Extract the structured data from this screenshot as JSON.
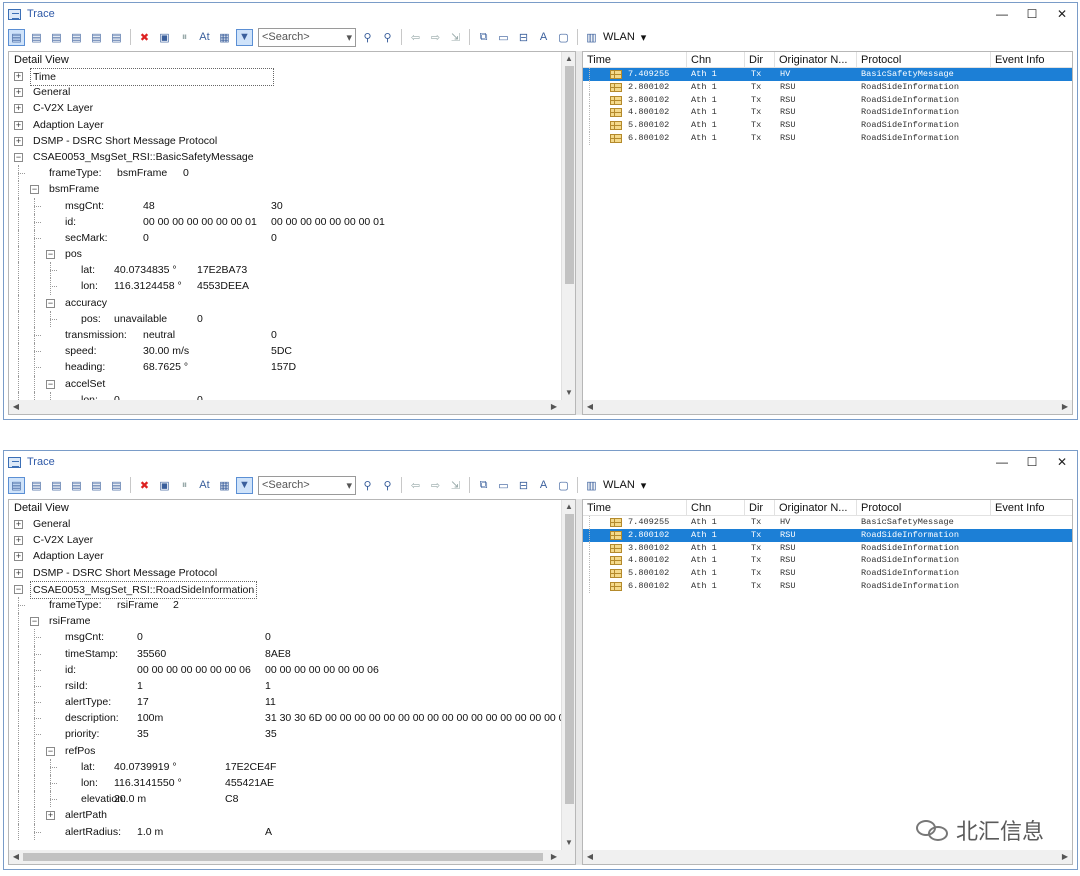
{
  "win1": {
    "title": "Trace",
    "search_placeholder": "<Search>",
    "wlan_label": "WLAN",
    "detail_header": "Detail View",
    "tree": [
      {
        "level": 0,
        "expander": "+",
        "label": "Time",
        "selected": true
      },
      {
        "level": 0,
        "expander": "+",
        "label": "General"
      },
      {
        "level": 0,
        "expander": "+",
        "label": "C-V2X Layer"
      },
      {
        "level": 0,
        "expander": "+",
        "label": "Adaption Layer"
      },
      {
        "level": 0,
        "expander": "+",
        "label": "DSMP - DSRC Short Message Protocol"
      },
      {
        "level": 0,
        "expander": "-",
        "label": "CSAE0053_MsgSet_RSI::BasicSafetyMessage"
      },
      {
        "level": 1,
        "label": "frameType:",
        "v1": "bsmFrame",
        "v2": "0"
      },
      {
        "level": 1,
        "expander": "-",
        "label": "bsmFrame"
      },
      {
        "level": 2,
        "label": "msgCnt:",
        "v1": "48",
        "v2": "30"
      },
      {
        "level": 2,
        "label": "id:",
        "v1": "00 00 00 00 00 00 00 01",
        "v2": "00 00 00 00 00 00 00 01"
      },
      {
        "level": 2,
        "label": "secMark:",
        "v1": "0",
        "v2": "0"
      },
      {
        "level": 2,
        "expander": "-",
        "label": "pos"
      },
      {
        "level": 3,
        "label": "lat:",
        "v1": "40.0734835 °",
        "v2": "17E2BA73"
      },
      {
        "level": 3,
        "label": "lon:",
        "v1": "116.3124458 °",
        "v2": "4553DEEA"
      },
      {
        "level": 2,
        "expander": "-",
        "label": "accuracy"
      },
      {
        "level": 3,
        "label": "pos:",
        "v1": "unavailable",
        "v2": "0"
      },
      {
        "level": 2,
        "label": "transmission:",
        "v1": "neutral",
        "v2": "0"
      },
      {
        "level": 2,
        "label": "speed:",
        "v1": "30.00 m/s",
        "v2": "5DC"
      },
      {
        "level": 2,
        "label": "heading:",
        "v1": "68.7625 °",
        "v2": "157D"
      },
      {
        "level": 2,
        "expander": "-",
        "label": "accelSet"
      },
      {
        "level": 3,
        "label": "lon:",
        "v1": "0",
        "v2": "0"
      },
      {
        "level": 3,
        "label": "lat:",
        "v1": "0",
        "v2": "0"
      }
    ],
    "selected_row": 0
  },
  "win2": {
    "title": "Trace",
    "search_placeholder": "<Search>",
    "wlan_label": "WLAN",
    "detail_header": "Detail View",
    "tree": [
      {
        "level": 0,
        "expander": "+",
        "label": "General"
      },
      {
        "level": 0,
        "expander": "+",
        "label": "C-V2X Layer"
      },
      {
        "level": 0,
        "expander": "+",
        "label": "Adaption Layer"
      },
      {
        "level": 0,
        "expander": "+",
        "label": "DSMP - DSRC Short Message Protocol"
      },
      {
        "level": 0,
        "expander": "-",
        "label": "CSAE0053_MsgSet_RSI::RoadSideInformation",
        "selected": true
      },
      {
        "level": 1,
        "label": "frameType:",
        "v1": "rsiFrame",
        "v2": "2"
      },
      {
        "level": 1,
        "expander": "-",
        "label": "rsiFrame"
      },
      {
        "level": 2,
        "label": "msgCnt:",
        "v1": "0",
        "v2": "0"
      },
      {
        "level": 2,
        "label": "timeStamp:",
        "v1": "35560",
        "v2": "8AE8"
      },
      {
        "level": 2,
        "label": "id:",
        "v1": "00 00 00 00 00 00 00 06",
        "v2": "00 00 00 00 00 00 00 06"
      },
      {
        "level": 2,
        "label": "rsiId:",
        "v1": "1",
        "v2": "1"
      },
      {
        "level": 2,
        "label": "alertType:",
        "v1": "17",
        "v2": "11"
      },
      {
        "level": 2,
        "label": "description:",
        "v1": "100m",
        "v2": "31 30 30 6D 00 00 00 00 00 00 00 00 00 00 00 00 00 00 00 00 00 00"
      },
      {
        "level": 2,
        "label": "priority:",
        "v1": "35",
        "v2": "35"
      },
      {
        "level": 2,
        "expander": "-",
        "label": "refPos"
      },
      {
        "level": 3,
        "label": "lat:",
        "v1": "40.0739919 °",
        "v2": "17E2CE4F"
      },
      {
        "level": 3,
        "label": "lon:",
        "v1": "116.3141550 °",
        "v2": "455421AE"
      },
      {
        "level": 3,
        "label": "elevation:",
        "v1": "20.0 m",
        "v2": "C8"
      },
      {
        "level": 2,
        "expander": "+",
        "label": "alertPath"
      },
      {
        "level": 2,
        "label": "alertRadius:",
        "v1": "1.0 m",
        "v2": "A"
      }
    ],
    "selected_row": 1
  },
  "columns": [
    "Time",
    "Chn",
    "Dir",
    "Originator N...",
    "Protocol",
    "Event Info"
  ],
  "trace_rows": [
    {
      "time": "7.409255",
      "chn": "Ath 1",
      "dir": "Tx",
      "orig": "HV",
      "proto": "BasicSafetyMessage"
    },
    {
      "time": "2.800102",
      "chn": "Ath 1",
      "dir": "Tx",
      "orig": "RSU",
      "proto": "RoadSideInformation"
    },
    {
      "time": "3.800102",
      "chn": "Ath 1",
      "dir": "Tx",
      "orig": "RSU",
      "proto": "RoadSideInformation"
    },
    {
      "time": "4.800102",
      "chn": "Ath 1",
      "dir": "Tx",
      "orig": "RSU",
      "proto": "RoadSideInformation"
    },
    {
      "time": "5.800102",
      "chn": "Ath 1",
      "dir": "Tx",
      "orig": "RSU",
      "proto": "RoadSideInformation"
    },
    {
      "time": "6.800102",
      "chn": "Ath 1",
      "dir": "Tx",
      "orig": "RSU",
      "proto": "RoadSideInformation"
    }
  ],
  "window_controls": [
    "—",
    "☐",
    "✕"
  ],
  "watermark": "北汇信息",
  "colors": {
    "selection": "#1c7fd6",
    "title_text": "#2f5aa8"
  }
}
